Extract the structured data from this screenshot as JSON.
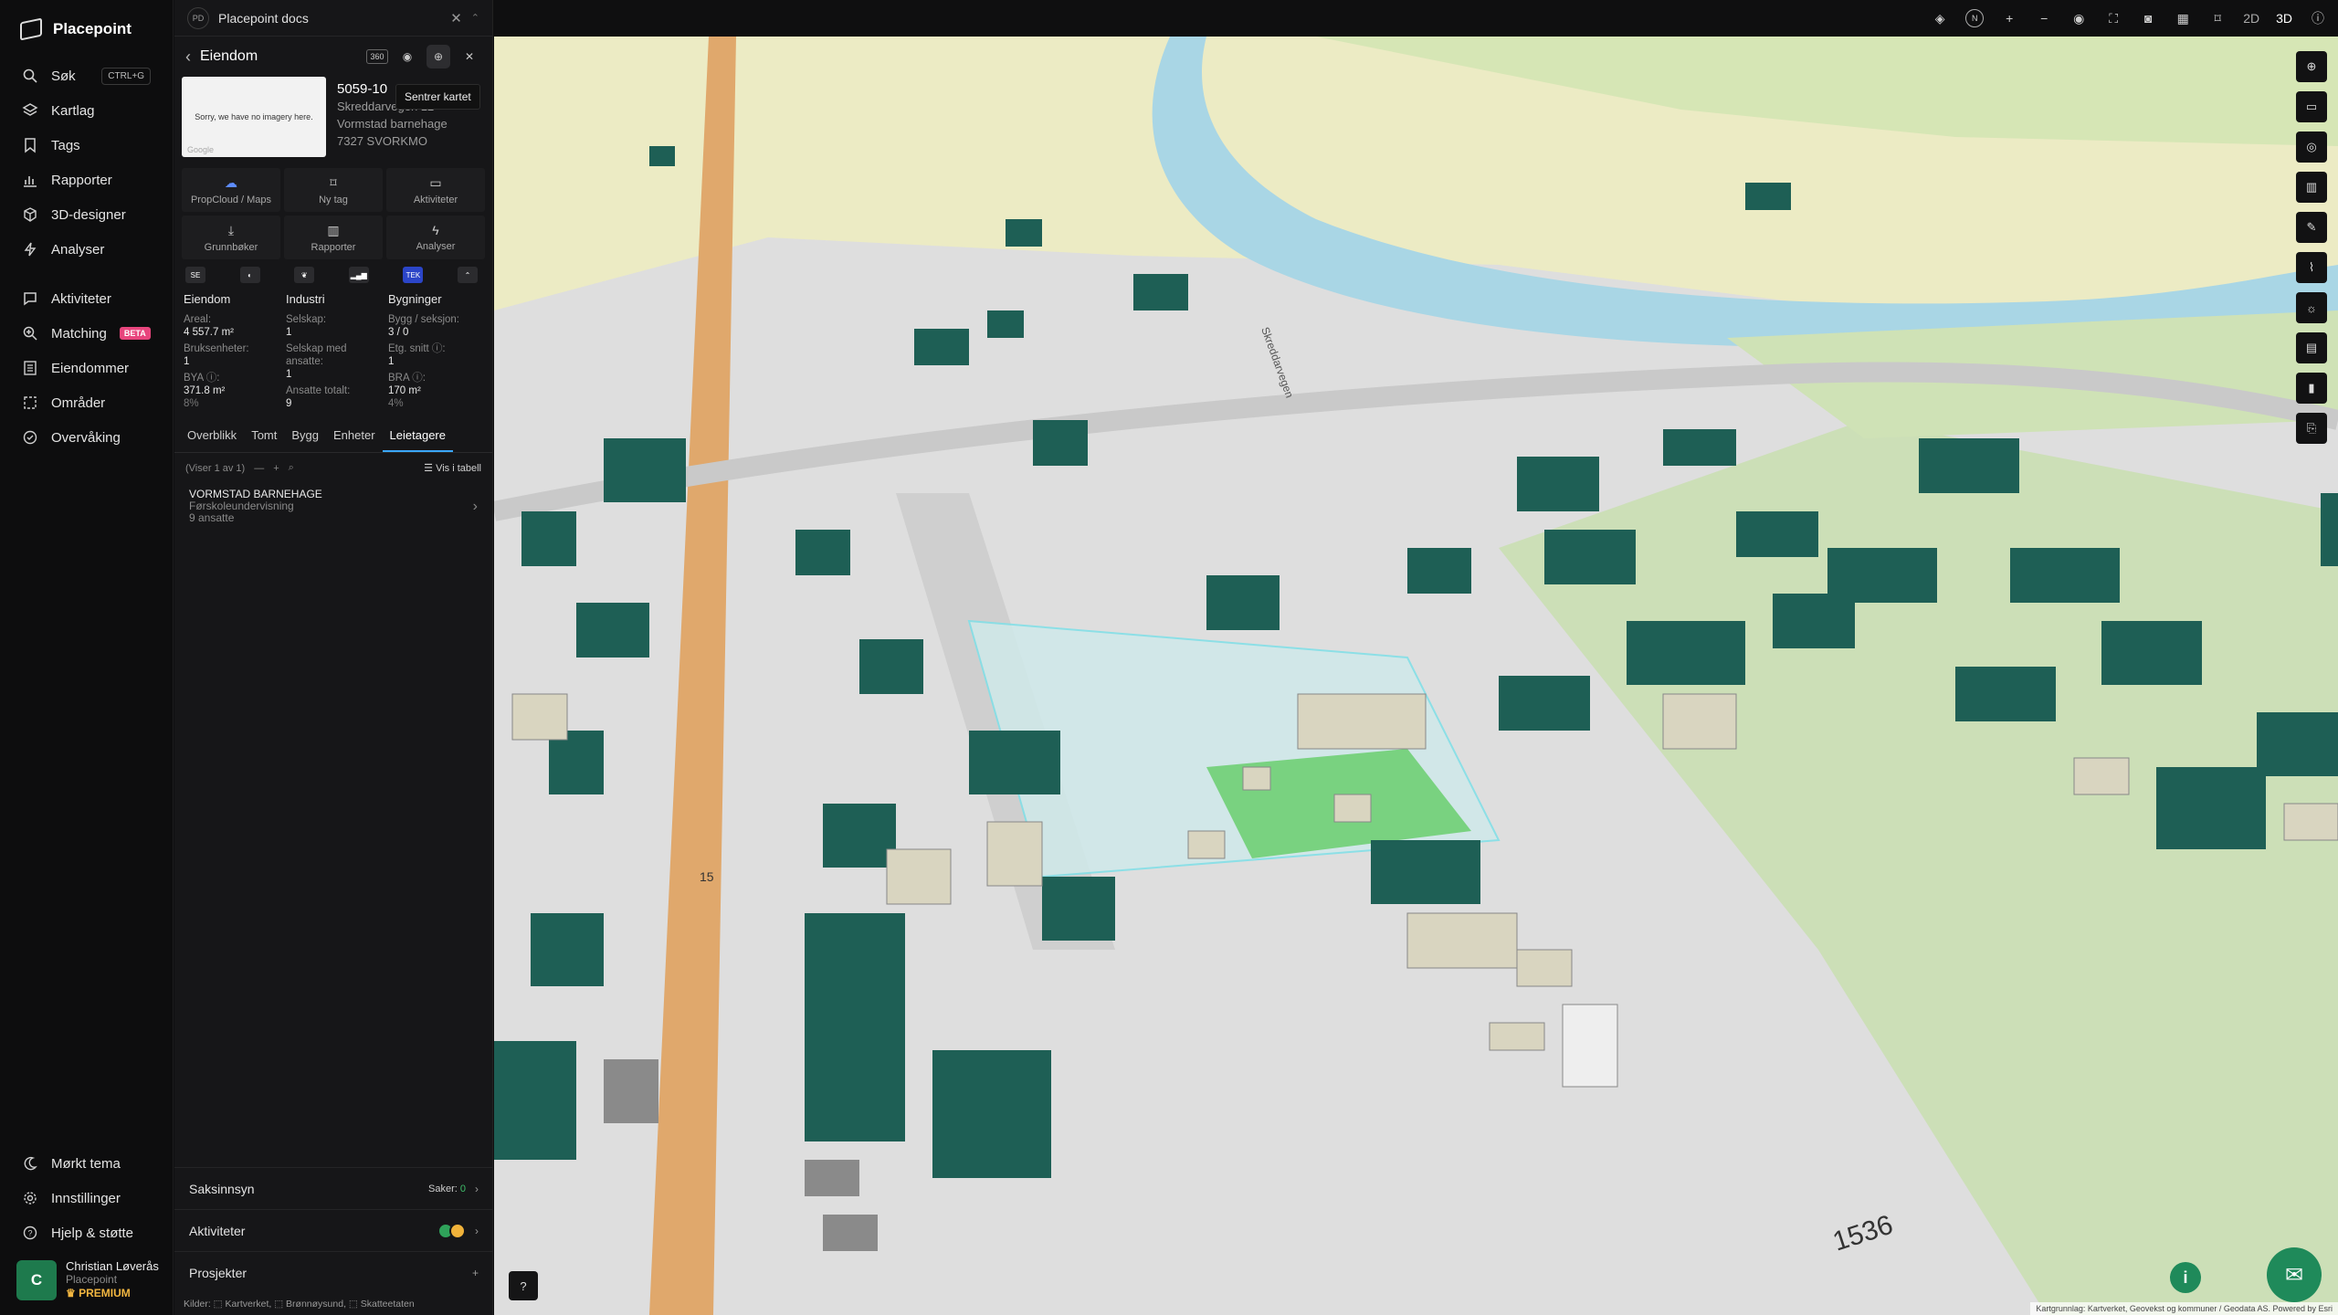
{
  "nav": {
    "brand": "Placepoint",
    "items": [
      {
        "label": "Søk",
        "icon": "search-icon",
        "shortcut": "CTRL+G"
      },
      {
        "label": "Kartlag",
        "icon": "layers-icon"
      },
      {
        "label": "Tags",
        "icon": "bookmark-icon"
      },
      {
        "label": "Rapporter",
        "icon": "bar-chart-icon"
      },
      {
        "label": "3D-designer",
        "icon": "cube-icon"
      },
      {
        "label": "Analyser",
        "icon": "lightning-icon"
      },
      {
        "label": "Aktiviteter",
        "icon": "chat-icon"
      },
      {
        "label": "Matching",
        "icon": "search-plus-icon",
        "badge": "BETA"
      },
      {
        "label": "Eiendommer",
        "icon": "building-list-icon"
      },
      {
        "label": "Områder",
        "icon": "area-icon"
      },
      {
        "label": "Overvåking",
        "icon": "watch-icon"
      }
    ],
    "bottom": [
      {
        "label": "Mørkt tema",
        "icon": "moon-icon"
      },
      {
        "label": "Innstillinger",
        "icon": "gear-icon"
      },
      {
        "label": "Hjelp & støtte",
        "icon": "help-icon"
      }
    ],
    "user": {
      "initial": "C",
      "name": "Christian Løverås",
      "org": "Placepoint",
      "plan": "PREMIUM"
    }
  },
  "panel": {
    "doc_tab": {
      "badge": "PD",
      "title": "Placepoint docs"
    },
    "header": {
      "title": "Eiendom",
      "badge": "360"
    },
    "tooltip": "Sentrer kartet",
    "property": {
      "thumb_text": "Sorry, we have no imagery here.",
      "thumb_credit": "Google",
      "id": "5059-10",
      "address": "Skreddarvegen 12",
      "tenant": "Vormstad barnehage",
      "postal": "7327 SVORKMO"
    },
    "actions": [
      {
        "label": "PropCloud / Maps",
        "icon": "cloud-icon"
      },
      {
        "label": "Ny tag",
        "icon": "bookmark-icon"
      },
      {
        "label": "Aktiviteter",
        "icon": "chat-icon"
      },
      {
        "label": "Grunnbøker",
        "icon": "download-icon"
      },
      {
        "label": "Rapporter",
        "icon": "bar-chart-icon"
      },
      {
        "label": "Analyser",
        "icon": "lightning-icon"
      }
    ],
    "mini_tabs": [
      "SE",
      "",
      "",
      "",
      "TEK",
      ""
    ],
    "stats": {
      "eiendom": {
        "title": "Eiendom",
        "areal_label": "Areal:",
        "areal": "4 557.7 m²",
        "bruk_label": "Bruksenheter:",
        "bruk": "1",
        "bya_label": "BYA ⓘ:",
        "bya": "371.8 m²",
        "bya_pct": "8%"
      },
      "industri": {
        "title": "Industri",
        "selskap_label": "Selskap:",
        "selskap": "1",
        "ansatte_label": "Selskap med ansatte:",
        "ansatte": "1",
        "totalt_label": "Ansatte totalt:",
        "totalt": "9"
      },
      "bygninger": {
        "title": "Bygninger",
        "seksjon_label": "Bygg / seksjon:",
        "seksjon": "3 / 0",
        "etg_label": "Etg. snitt ⓘ:",
        "etg": "1",
        "bra_label": "BRA ⓘ:",
        "bra": "170 m²",
        "bra_pct": "4%"
      }
    },
    "tabs": [
      "Overblikk",
      "Tomt",
      "Bygg",
      "Enheter",
      "Leietagere"
    ],
    "active_tab": "Leietagere",
    "list": {
      "count_text": "(Viser 1 av 1)",
      "table_link": "Vis i tabell",
      "rows": [
        {
          "name": "VORMSTAD BARNEHAGE",
          "category": "Førskoleundervisning",
          "employees": "9 ansatte"
        }
      ]
    },
    "sections": {
      "saksinnsyn": {
        "label": "Saksinnsyn",
        "meta_label": "Saker:",
        "meta_value": "0"
      },
      "aktiviteter": {
        "label": "Aktiviteter"
      },
      "prosjekter": {
        "label": "Prosjekter"
      }
    },
    "sources": "Kilder: ⬚ Kartverket, ⬚ Brønnøysund, ⬚ Skatteetaten"
  },
  "map": {
    "topbar": {
      "compass": "N",
      "mode_2d": "2D",
      "mode_3d": "3D"
    },
    "labels": [
      "Skreddarvegen",
      "1536",
      "15"
    ],
    "attribution": "Kartgrunnlag: Kartverket, Geovekst og kommuner / Geodata AS. Powered by Esri",
    "colors": {
      "building": "#1e5f55",
      "building_light": "#d9d5c0",
      "selection": "#7ee0e8",
      "lot": "#6fcf74",
      "river": "#a9d6e5",
      "field": "#ecebc4",
      "road": "#e0a86c",
      "ground": "#dcdcdc"
    }
  }
}
